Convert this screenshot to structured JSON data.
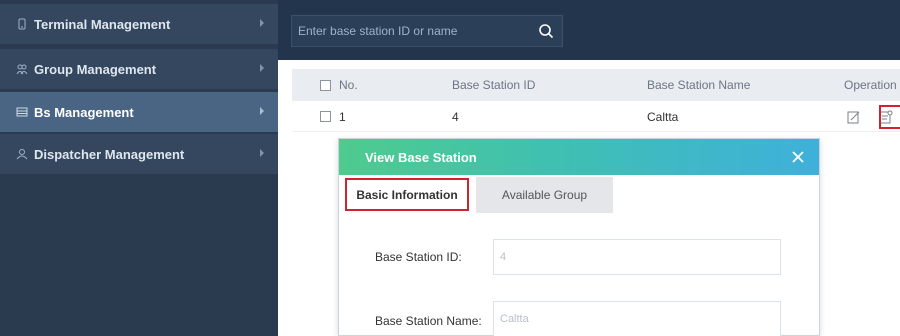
{
  "sidebar": {
    "items": [
      {
        "label": "Terminal Management",
        "icon": "terminal-icon",
        "active": false
      },
      {
        "label": "Group Management",
        "icon": "group-icon",
        "active": false
      },
      {
        "label": "Bs Management",
        "icon": "base-station-icon",
        "active": true
      },
      {
        "label": "Dispatcher Management",
        "icon": "dispatcher-icon",
        "active": false
      }
    ]
  },
  "search": {
    "placeholder": "Enter base station ID or name",
    "icon": "search-icon"
  },
  "table": {
    "headers": {
      "no": "No.",
      "id": "Base Station ID",
      "name": "Base Station Name",
      "operation": "Operation"
    },
    "rows": [
      {
        "no": "1",
        "id": "4",
        "name": "Caltta"
      }
    ]
  },
  "modal": {
    "title": "View Base Station",
    "tabs": [
      {
        "label": "Basic Information",
        "active": true
      },
      {
        "label": "Available Group",
        "active": false
      }
    ],
    "fields": [
      {
        "label": "Base Station ID:",
        "value": "4"
      },
      {
        "label": "Base Station Name:",
        "value": "Caltta"
      }
    ]
  },
  "colors": {
    "sidebar_bg": "#2a3a4f",
    "sidebar_active": "#4a6583",
    "topbar_bg": "#22354c",
    "highlight": "#d0232f",
    "modal_gradient_start": "#4fcb8e",
    "modal_gradient_end": "#3fb0db"
  }
}
